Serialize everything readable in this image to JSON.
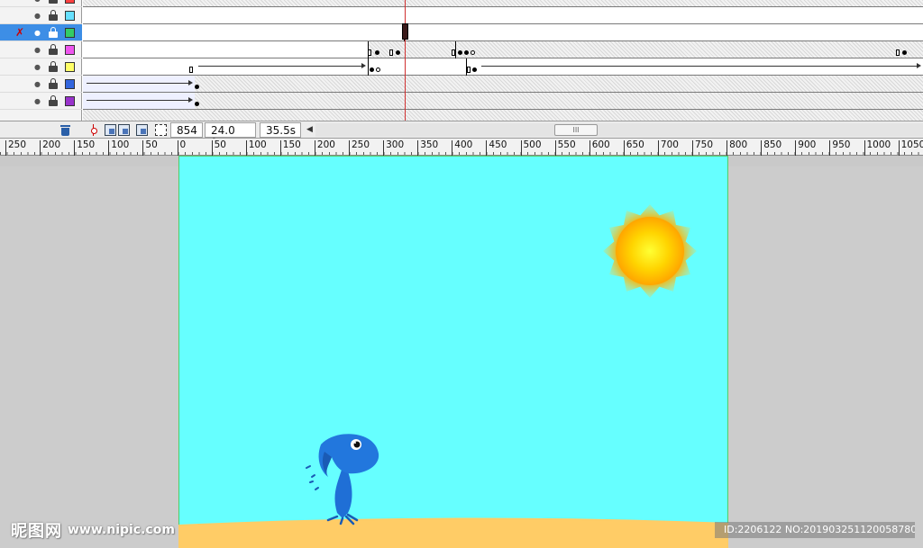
{
  "timeline": {
    "layers": [
      {
        "color": "#ff4040",
        "selected": false
      },
      {
        "color": "#66e0ff",
        "selected": false
      },
      {
        "color": "#33cc66",
        "selected": true
      },
      {
        "color": "#ee55ee",
        "selected": false
      },
      {
        "color": "#ffff66",
        "selected": false
      },
      {
        "color": "#3366dd",
        "selected": false
      },
      {
        "color": "#9933cc",
        "selected": false
      }
    ],
    "current_frame": "854",
    "frame_rate": "24.0 fps",
    "elapsed_time": "35.5s",
    "scroll_thumb_glyph": "III"
  },
  "ruler": {
    "labels": [
      "250",
      "200",
      "150",
      "100",
      "50",
      "0",
      "50",
      "100",
      "150",
      "200",
      "250",
      "300",
      "350",
      "400",
      "450",
      "500",
      "550",
      "600",
      "650",
      "700",
      "750",
      "800",
      "850",
      "900",
      "950",
      "1000",
      "1050"
    ]
  },
  "stage": {
    "background_color": "#66ffff",
    "ground_color": "#ffcc66",
    "sun_color": "#ffcc00"
  },
  "watermark": {
    "brand": "昵图网",
    "url": "www.nipic.com",
    "id_text": "ID:2206122 NO:20190325112005878000"
  }
}
